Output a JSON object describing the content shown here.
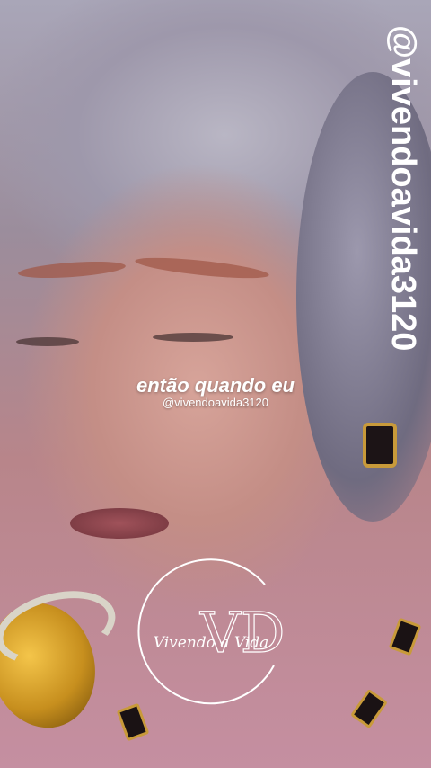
{
  "watermark": {
    "handle_vertical": "@vivendoavida3120"
  },
  "caption": {
    "text": "então quando eu",
    "handle": "@vivendoavida3120"
  },
  "logo": {
    "text": "Vivendo a Vida",
    "monogram": "VD"
  },
  "colors": {
    "caption": "#ffffff",
    "logo": "#ffffff",
    "microphone": "#e0a82e"
  }
}
